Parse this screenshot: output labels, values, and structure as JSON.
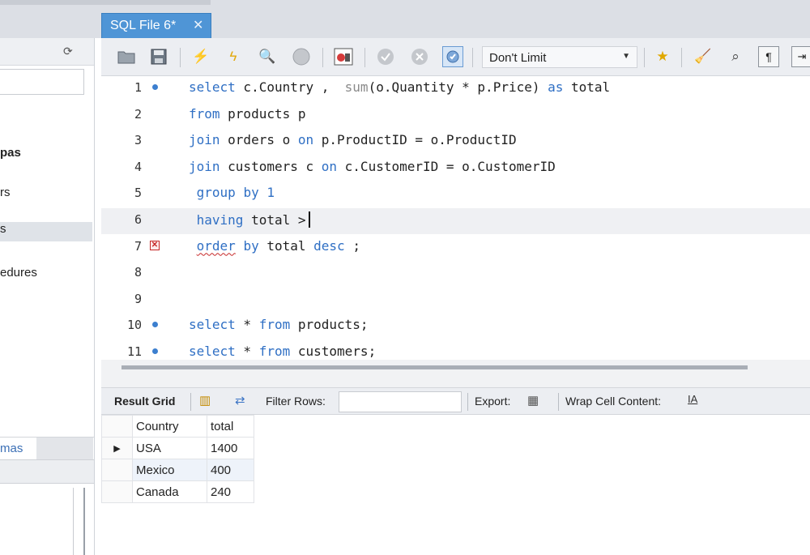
{
  "editor_tab": {
    "title": "SQL File 6*",
    "close_glyph": "✕"
  },
  "sidebar": {
    "items": [
      {
        "text": "pas",
        "bold": true
      },
      {
        "text": "rs"
      },
      {
        "text": "s",
        "selected": true
      },
      {
        "text": "edures"
      }
    ],
    "schemas_tab": "mas"
  },
  "toolbar": {
    "limit_select": {
      "value": "Don't Limit"
    },
    "icons": [
      "open-file-icon",
      "save-icon",
      "execute-icon",
      "execute-current-icon",
      "explain-icon",
      "stop-icon",
      "toggle-results-icon",
      "commit-icon",
      "rollback-icon",
      "autocommit-icon",
      "bookmark-icon",
      "beautify-icon",
      "find-icon",
      "invisible-chars-icon",
      "wrap-icon"
    ]
  },
  "editor": {
    "lines": [
      {
        "n": "1",
        "marker": "dot",
        "tokens": [
          [
            "kw",
            "select"
          ],
          [
            "t",
            " c.Country ,  "
          ],
          [
            "fn",
            "sum"
          ],
          [
            "t",
            "(o.Quantity * p.Price) "
          ],
          [
            "kw",
            "as"
          ],
          [
            "t",
            " total"
          ]
        ]
      },
      {
        "n": "2",
        "marker": "",
        "tokens": [
          [
            "kw",
            "from"
          ],
          [
            "t",
            " products p"
          ]
        ]
      },
      {
        "n": "3",
        "marker": "",
        "tokens": [
          [
            "kw",
            "join"
          ],
          [
            "t",
            " orders o "
          ],
          [
            "kw",
            "on"
          ],
          [
            "t",
            " p.ProductID = o.ProductID"
          ]
        ]
      },
      {
        "n": "4",
        "marker": "",
        "tokens": [
          [
            "kw",
            "join"
          ],
          [
            "t",
            " customers c "
          ],
          [
            "kw",
            "on"
          ],
          [
            "t",
            " c.CustomerID = o.CustomerID"
          ]
        ]
      },
      {
        "n": "5",
        "marker": "",
        "tokens": [
          [
            "t",
            " "
          ],
          [
            "kw",
            "group by"
          ],
          [
            "t",
            " "
          ],
          [
            "kw",
            "1"
          ]
        ]
      },
      {
        "n": "6",
        "marker": "",
        "current": true,
        "tokens": [
          [
            "t",
            " "
          ],
          [
            "kw",
            "having"
          ],
          [
            "t",
            " total >"
          ],
          [
            "caret",
            ""
          ]
        ]
      },
      {
        "n": "7",
        "marker": "err",
        "tokens": [
          [
            "t",
            " "
          ],
          [
            "err",
            "order"
          ],
          [
            "t",
            " "
          ],
          [
            "kw",
            "by"
          ],
          [
            "t",
            " total "
          ],
          [
            "kw",
            "desc"
          ],
          [
            "t",
            " ;"
          ]
        ]
      },
      {
        "n": "8",
        "marker": "",
        "tokens": []
      },
      {
        "n": "9",
        "marker": "",
        "tokens": []
      },
      {
        "n": "10",
        "marker": "dot",
        "tokens": [
          [
            "kw",
            "select"
          ],
          [
            "t",
            " * "
          ],
          [
            "kw",
            "from"
          ],
          [
            "t",
            " products;"
          ]
        ]
      },
      {
        "n": "11",
        "marker": "dot",
        "tokens": [
          [
            "kw",
            "select"
          ],
          [
            "t",
            " * "
          ],
          [
            "kw",
            "from"
          ],
          [
            "t",
            " customers;"
          ]
        ]
      }
    ]
  },
  "result_toolbar": {
    "result_grid_label": "Result Grid",
    "filter_label": "Filter Rows:",
    "filter_value": "",
    "export_label": "Export:",
    "wrap_label": "Wrap Cell Content:"
  },
  "result_grid": {
    "columns": [
      "Country",
      "total"
    ],
    "rows": [
      {
        "country": "USA",
        "total": "1400",
        "current": true
      },
      {
        "country": "Mexico",
        "total": "400"
      },
      {
        "country": "Canada",
        "total": "240"
      }
    ]
  },
  "colors": {
    "tab_blue": "#4f95d6",
    "keyword": "#2f6fc4",
    "error": "#c62828"
  }
}
